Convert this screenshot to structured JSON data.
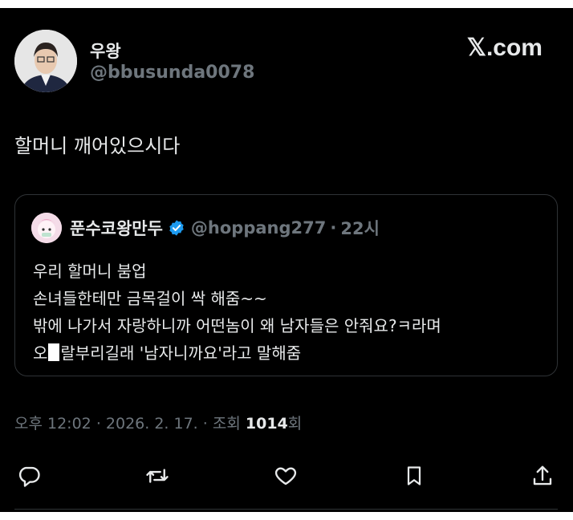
{
  "author": {
    "display_name": "우왕",
    "handle": "@bbusunda0078"
  },
  "brand": "𝕏.com",
  "tweet": {
    "text": "할머니 깨어있으시다"
  },
  "quoted": {
    "display_name": "푼수코왕만두",
    "handle": "@hoppang277",
    "separator": "·",
    "time": "22시",
    "lines": [
      "우리 할머니 붐업",
      "손녀들한테만 금목걸이 싹 해줌~~",
      "밖에 나가서 자랑하니까 어떤놈이 왜 남자들은 안줘요?ㅋ라며",
      "오",
      "랄부리길래 '남자니까요'라고 말해줌"
    ]
  },
  "meta": {
    "time": "오후 12:02",
    "date": "2026. 2. 17.",
    "views_label": "조회",
    "views_count": "1014",
    "views_suffix": "회",
    "separator": "·"
  },
  "icons": {
    "reply": "reply-icon",
    "retweet": "retweet-icon",
    "like": "heart-icon",
    "bookmark": "bookmark-icon",
    "share": "share-icon",
    "verified": "verified-badge-icon"
  },
  "colors": {
    "background": "#000000",
    "text": "#e7e9ea",
    "muted": "#6e767d",
    "verified": "#1d9bf0",
    "border": "#2f3336"
  }
}
